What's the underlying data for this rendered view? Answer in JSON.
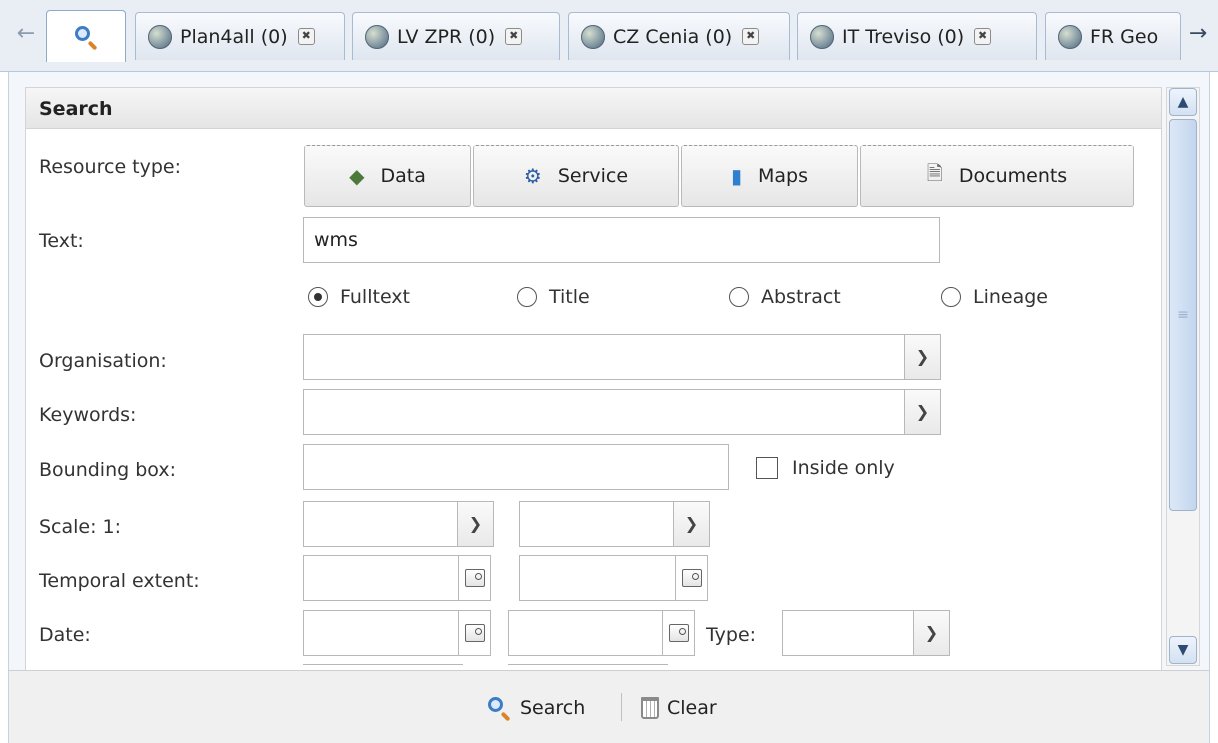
{
  "tabs": {
    "active_tab_icon": "search-icon",
    "items": [
      {
        "label": "Plan4all (0)",
        "icon": "globe-icon"
      },
      {
        "label": "LV ZPR (0)",
        "icon": "globe-icon"
      },
      {
        "label": "CZ Cenia (0)",
        "icon": "globe-icon"
      },
      {
        "label": "IT Treviso (0)",
        "icon": "globe-icon"
      },
      {
        "label": "FR Geo",
        "icon": "globe-icon"
      }
    ],
    "scroll_left": "←",
    "scroll_right": "→",
    "close_symbol": "✖"
  },
  "panel": {
    "title": "Search"
  },
  "form": {
    "resource_type": {
      "label": "Resource type:",
      "buttons": [
        {
          "label": "Data",
          "icon": "data-layers-icon"
        },
        {
          "label": "Service",
          "icon": "gear-icon"
        },
        {
          "label": "Maps",
          "icon": "map-icon"
        },
        {
          "label": "Documents",
          "icon": "document-icon"
        }
      ]
    },
    "text": {
      "label": "Text:",
      "value": "wms",
      "modes": [
        {
          "label": "Fulltext",
          "checked": true
        },
        {
          "label": "Title",
          "checked": false
        },
        {
          "label": "Abstract",
          "checked": false
        },
        {
          "label": "Lineage",
          "checked": false
        }
      ]
    },
    "organisation": {
      "label": "Organisation:",
      "value": ""
    },
    "keywords": {
      "label": "Keywords:",
      "value": ""
    },
    "bounding_box": {
      "label": "Bounding box:",
      "value": "",
      "inside_only_label": "Inside only",
      "inside_only_checked": false
    },
    "scale": {
      "label": "Scale: 1:",
      "from": "",
      "to": ""
    },
    "temporal_extent": {
      "label": "Temporal extent:",
      "from": "",
      "to": ""
    },
    "date": {
      "label": "Date:",
      "from": "",
      "to": "",
      "type_label": "Type:",
      "type_value": ""
    }
  },
  "footer": {
    "search_label": "Search",
    "clear_label": "Clear"
  },
  "colors": {
    "accent": "#3e7cc4",
    "tab_border": "#a9bbd3",
    "scroll_thumb": "#c3d6ee"
  }
}
